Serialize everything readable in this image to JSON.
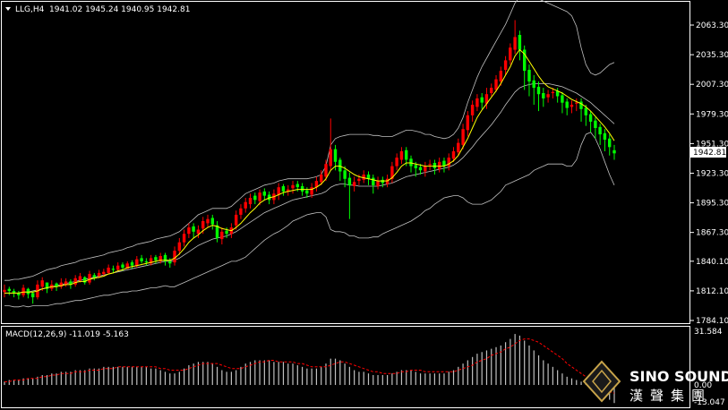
{
  "header": {
    "symbol": "LLG,H4",
    "ohlc": "1941.02 1945.24 1940.95 1942.81"
  },
  "current_price": "1942.81",
  "macd": {
    "label": "MACD(12,26,9) -11.019 -5.163",
    "top_label": "31.584",
    "mid_label": "0.00",
    "bot_label": "-13.047"
  },
  "brand": {
    "name": "SINO SOUND",
    "chinese": "漢聲集團"
  },
  "colors": {
    "bull": "#ff0000",
    "bear": "#00ff00",
    "ma": "#ffff00",
    "bands": "#c0c0c0",
    "signal": "#ff0000",
    "hist": "#c0c0c0"
  },
  "chart_data": {
    "type": "candlestick",
    "price_axis": [
      "2063.30",
      "2035.30",
      "2007.30",
      "1979.30",
      "1951.30",
      "1923.30",
      "1895.30",
      "1867.30",
      "1840.10",
      "1812.10",
      "1784.10"
    ],
    "ylim": [
      1784.1,
      2063.3
    ],
    "close": [
      1813,
      1812,
      1810,
      1808,
      1815,
      1809,
      1806,
      1818,
      1822,
      1814,
      1818,
      1816,
      1820,
      1821,
      1818,
      1824,
      1826,
      1820,
      1828,
      1825,
      1829,
      1830,
      1834,
      1832,
      1836,
      1834,
      1838,
      1836,
      1842,
      1840,
      1839,
      1843,
      1841,
      1845,
      1840,
      1838,
      1850,
      1858,
      1866,
      1872,
      1868,
      1870,
      1878,
      1880,
      1875,
      1862,
      1868,
      1866,
      1872,
      1884,
      1890,
      1896,
      1900,
      1898,
      1905,
      1902,
      1898,
      1904,
      1910,
      1906,
      1908,
      1912,
      1910,
      1906,
      1904,
      1910,
      1916,
      1922,
      1932,
      1946,
      1934,
      1925,
      1918,
      1912,
      1915,
      1918,
      1922,
      1918,
      1912,
      1916,
      1914,
      1918,
      1930,
      1938,
      1944,
      1936,
      1930,
      1928,
      1926,
      1930,
      1932,
      1928,
      1934,
      1930,
      1938,
      1944,
      1952,
      1965,
      1978,
      1988,
      1994,
      1990,
      1998,
      2004,
      2012,
      2020,
      2030,
      2042,
      2052,
      2040,
      2020,
      2010,
      2004,
      1998,
      1994,
      1998,
      2000,
      1996,
      1990,
      1985,
      1988,
      1990,
      1984,
      1978,
      1972,
      1966,
      1960,
      1955,
      1948,
      1942
    ],
    "open": [
      1811,
      1814,
      1812,
      1810,
      1808,
      1814,
      1810,
      1806,
      1816,
      1820,
      1814,
      1819,
      1816,
      1818,
      1821,
      1818,
      1822,
      1825,
      1820,
      1827,
      1826,
      1828,
      1829,
      1833,
      1832,
      1837,
      1833,
      1839,
      1836,
      1843,
      1840,
      1838,
      1844,
      1840,
      1846,
      1840,
      1839,
      1850,
      1858,
      1866,
      1873,
      1866,
      1871,
      1876,
      1881,
      1874,
      1861,
      1869,
      1866,
      1874,
      1884,
      1890,
      1894,
      1902,
      1897,
      1906,
      1903,
      1898,
      1903,
      1911,
      1906,
      1909,
      1913,
      1911,
      1907,
      1903,
      1910,
      1915,
      1920,
      1930,
      1946,
      1936,
      1926,
      1919,
      1911,
      1916,
      1917,
      1922,
      1919,
      1911,
      1917,
      1913,
      1918,
      1930,
      1936,
      1945,
      1937,
      1931,
      1929,
      1925,
      1931,
      1933,
      1927,
      1935,
      1930,
      1937,
      1943,
      1950,
      1964,
      1978,
      1986,
      1995,
      1989,
      1999,
      2002,
      2010,
      2021,
      2030,
      2040,
      2054,
      2040,
      2021,
      2011,
      2005,
      1999,
      1995,
      1999,
      2001,
      1997,
      1991,
      1986,
      1989,
      1991,
      1985,
      1979,
      1973,
      1967,
      1961,
      1956,
      1945
    ],
    "high": [
      1818,
      1816,
      1814,
      1812,
      1818,
      1815,
      1812,
      1822,
      1825,
      1820,
      1822,
      1820,
      1824,
      1824,
      1823,
      1827,
      1829,
      1826,
      1831,
      1829,
      1832,
      1833,
      1837,
      1836,
      1839,
      1839,
      1840,
      1841,
      1845,
      1846,
      1843,
      1846,
      1846,
      1848,
      1848,
      1843,
      1854,
      1862,
      1870,
      1876,
      1876,
      1874,
      1882,
      1884,
      1884,
      1878,
      1872,
      1872,
      1876,
      1888,
      1894,
      1900,
      1904,
      1905,
      1908,
      1909,
      1906,
      1908,
      1914,
      1913,
      1912,
      1916,
      1916,
      1914,
      1910,
      1914,
      1920,
      1926,
      1936,
      1975,
      1950,
      1938,
      1930,
      1924,
      1920,
      1922,
      1926,
      1925,
      1922,
      1920,
      1920,
      1922,
      1934,
      1942,
      1948,
      1948,
      1940,
      1934,
      1932,
      1934,
      1936,
      1936,
      1938,
      1938,
      1942,
      1948,
      1956,
      1970,
      1982,
      1992,
      1998,
      1999,
      2004,
      2008,
      2016,
      2024,
      2034,
      2046,
      2068,
      2058,
      2044,
      2026,
      2016,
      2010,
      2004,
      2002,
      2004,
      2004,
      2000,
      1994,
      1992,
      1994,
      1994,
      1988,
      1982,
      1976,
      1970,
      1965,
      1960,
      1950
    ],
    "low": [
      1806,
      1808,
      1806,
      1804,
      1806,
      1805,
      1800,
      1804,
      1812,
      1810,
      1812,
      1812,
      1814,
      1816,
      1814,
      1816,
      1820,
      1818,
      1818,
      1822,
      1824,
      1826,
      1828,
      1829,
      1831,
      1831,
      1833,
      1833,
      1834,
      1838,
      1836,
      1836,
      1838,
      1838,
      1836,
      1834,
      1836,
      1846,
      1854,
      1862,
      1862,
      1862,
      1866,
      1872,
      1870,
      1858,
      1856,
      1862,
      1862,
      1870,
      1880,
      1886,
      1890,
      1894,
      1893,
      1898,
      1894,
      1894,
      1898,
      1902,
      1902,
      1904,
      1906,
      1902,
      1900,
      1900,
      1906,
      1912,
      1916,
      1926,
      1926,
      1916,
      1910,
      1880,
      1906,
      1912,
      1914,
      1912,
      1904,
      1908,
      1910,
      1910,
      1914,
      1926,
      1932,
      1930,
      1924,
      1920,
      1922,
      1920,
      1926,
      1922,
      1924,
      1924,
      1926,
      1934,
      1940,
      1946,
      1958,
      1972,
      1982,
      1984,
      1984,
      1996,
      2000,
      2006,
      2016,
      2026,
      2036,
      2030,
      2002,
      1996,
      1988,
      1982,
      1986,
      1990,
      1994,
      1990,
      1980,
      1978,
      1980,
      1982,
      1972,
      1968,
      1962,
      1956,
      1950,
      1944,
      1940,
      1936
    ],
    "bands_upper": [
      1822,
      1822,
      1823,
      1823,
      1824,
      1825,
      1826,
      1828,
      1830,
      1832,
      1833,
      1834,
      1836,
      1837,
      1838,
      1839,
      1841,
      1842,
      1843,
      1844,
      1845,
      1846,
      1848,
      1849,
      1850,
      1851,
      1853,
      1854,
      1856,
      1857,
      1858,
      1859,
      1861,
      1862,
      1863,
      1864,
      1866,
      1868,
      1872,
      1876,
      1880,
      1884,
      1886,
      1888,
      1890,
      1890,
      1890,
      1890,
      1892,
      1896,
      1900,
      1904,
      1906,
      1908,
      1910,
      1912,
      1913,
      1914,
      1916,
      1917,
      1918,
      1918,
      1918,
      1918,
      1918,
      1919,
      1920,
      1922,
      1930,
      1950,
      1956,
      1958,
      1959,
      1960,
      1960,
      1960,
      1960,
      1960,
      1959,
      1959,
      1958,
      1958,
      1958,
      1960,
      1962,
      1964,
      1964,
      1963,
      1962,
      1960,
      1960,
      1958,
      1957,
      1956,
      1957,
      1960,
      1966,
      1976,
      1990,
      2002,
      2014,
      2024,
      2032,
      2040,
      2048,
      2056,
      2064,
      2074,
      2084,
      2090,
      2092,
      2092,
      2090,
      2088,
      2086,
      2084,
      2082,
      2080,
      2078,
      2076,
      2072,
      2062,
      2042,
      2026,
      2018,
      2016,
      2018,
      2022,
      2026,
      2028
    ],
    "bands_middle": [
      1810,
      1810,
      1810,
      1810,
      1811,
      1811,
      1812,
      1813,
      1814,
      1815,
      1816,
      1817,
      1818,
      1819,
      1820,
      1821,
      1822,
      1823,
      1824,
      1825,
      1826,
      1827,
      1828,
      1829,
      1830,
      1831,
      1832,
      1833,
      1834,
      1835,
      1836,
      1837,
      1838,
      1839,
      1840,
      1840,
      1841,
      1843,
      1846,
      1849,
      1852,
      1855,
      1857,
      1859,
      1861,
      1862,
      1863,
      1864,
      1866,
      1868,
      1871,
      1874,
      1877,
      1880,
      1883,
      1886,
      1888,
      1890,
      1892,
      1894,
      1896,
      1898,
      1899,
      1900,
      1901,
      1902,
      1903,
      1904,
      1906,
      1910,
      1912,
      1913,
      1913,
      1912,
      1912,
      1911,
      1911,
      1911,
      1911,
      1911,
      1912,
      1913,
      1914,
      1916,
      1918,
      1920,
      1921,
      1922,
      1923,
      1924,
      1925,
      1926,
      1927,
      1928,
      1929,
      1931,
      1934,
      1938,
      1943,
      1948,
      1954,
      1959,
      1964,
      1969,
      1975,
      1981,
      1988,
      1994,
      2000,
      2004,
      2006,
      2007,
      2008,
      2008,
      2008,
      2008,
      2007,
      2006,
      2005,
      2003,
      2001,
      1999,
      1996,
      1993,
      1990,
      1986,
      1982,
      1978,
      1974,
      1970
    ],
    "bands_lower": [
      1798,
      1798,
      1797,
      1797,
      1798,
      1797,
      1798,
      1798,
      1798,
      1798,
      1799,
      1800,
      1800,
      1801,
      1802,
      1803,
      1803,
      1804,
      1805,
      1806,
      1807,
      1808,
      1808,
      1809,
      1810,
      1811,
      1811,
      1812,
      1812,
      1813,
      1814,
      1815,
      1815,
      1816,
      1817,
      1816,
      1816,
      1818,
      1820,
      1822,
      1824,
      1826,
      1828,
      1830,
      1832,
      1834,
      1836,
      1838,
      1840,
      1840,
      1842,
      1844,
      1848,
      1852,
      1856,
      1860,
      1863,
      1866,
      1868,
      1871,
      1874,
      1878,
      1880,
      1882,
      1884,
      1885,
      1886,
      1886,
      1882,
      1870,
      1868,
      1868,
      1867,
      1864,
      1864,
      1862,
      1862,
      1862,
      1863,
      1863,
      1866,
      1868,
      1870,
      1872,
      1874,
      1876,
      1878,
      1881,
      1884,
      1888,
      1890,
      1894,
      1897,
      1900,
      1901,
      1902,
      1902,
      1900,
      1896,
      1894,
      1894,
      1894,
      1896,
      1898,
      1902,
      1906,
      1912,
      1914,
      1916,
      1918,
      1920,
      1922,
      1926,
      1928,
      1930,
      1932,
      1932,
      1932,
      1932,
      1930,
      1930,
      1936,
      1950,
      1960,
      1962,
      1956,
      1946,
      1934,
      1922,
      1912
    ],
    "ma": [
      1810,
      1810,
      1810,
      1810,
      1811,
      1811,
      1811,
      1812,
      1814,
      1815,
      1816,
      1816,
      1817,
      1818,
      1818,
      1820,
      1821,
      1821,
      1823,
      1824,
      1825,
      1826,
      1828,
      1829,
      1831,
      1832,
      1834,
      1835,
      1836,
      1837,
      1838,
      1839,
      1840,
      1841,
      1841,
      1841,
      1843,
      1847,
      1852,
      1858,
      1862,
      1865,
      1869,
      1872,
      1874,
      1873,
      1871,
      1870,
      1869,
      1872,
      1876,
      1881,
      1886,
      1890,
      1895,
      1898,
      1900,
      1901,
      1903,
      1905,
      1906,
      1907,
      1908,
      1908,
      1908,
      1908,
      1910,
      1913,
      1918,
      1926,
      1930,
      1930,
      1928,
      1925,
      1922,
      1920,
      1919,
      1918,
      1917,
      1916,
      1916,
      1916,
      1919,
      1924,
      1930,
      1933,
      1933,
      1932,
      1931,
      1930,
      1930,
      1930,
      1930,
      1930,
      1932,
      1935,
      1940,
      1948,
      1956,
      1966,
      1976,
      1983,
      1989,
      1995,
      2001,
      2008,
      2016,
      2024,
      2034,
      2040,
      2036,
      2029,
      2022,
      2015,
      2009,
      2005,
      2003,
      2001,
      1999,
      1996,
      1993,
      1991,
      1989,
      1986,
      1982,
      1977,
      1972,
      1967,
      1961,
      1954
    ],
    "macd_hist": [
      2,
      3,
      3,
      3,
      4,
      4,
      4,
      5,
      6,
      6,
      7,
      7,
      8,
      8,
      8,
      9,
      9,
      9,
      10,
      10,
      10,
      11,
      11,
      11,
      11,
      11,
      11,
      11,
      11,
      11,
      11,
      10,
      10,
      9,
      8,
      7,
      7,
      8,
      10,
      12,
      13,
      14,
      14,
      14,
      13,
      11,
      9,
      8,
      8,
      9,
      11,
      13,
      14,
      15,
      15,
      15,
      15,
      14,
      14,
      14,
      13,
      13,
      12,
      11,
      10,
      10,
      10,
      11,
      13,
      16,
      16,
      15,
      13,
      11,
      9,
      8,
      8,
      7,
      6,
      6,
      6,
      6,
      7,
      8,
      9,
      9,
      9,
      8,
      7,
      7,
      7,
      7,
      7,
      7,
      8,
      9,
      11,
      13,
      15,
      17,
      19,
      20,
      21,
      22,
      23,
      24,
      26,
      28,
      31,
      30,
      27,
      24,
      21,
      18,
      15,
      13,
      11,
      9,
      7,
      5,
      4,
      3,
      2,
      1,
      0,
      -2,
      -4,
      -6,
      -9,
      -11
    ],
    "macd_signal": [
      2,
      2,
      3,
      3,
      3,
      4,
      4,
      4,
      5,
      5,
      6,
      6,
      7,
      7,
      7,
      8,
      8,
      8,
      9,
      9,
      9,
      10,
      10,
      10,
      11,
      11,
      11,
      11,
      11,
      11,
      11,
      11,
      11,
      10,
      10,
      9,
      9,
      9,
      9,
      10,
      11,
      12,
      13,
      13,
      13,
      13,
      12,
      11,
      10,
      10,
      10,
      11,
      12,
      13,
      14,
      14,
      15,
      15,
      14,
      14,
      14,
      14,
      13,
      13,
      12,
      11,
      11,
      11,
      11,
      12,
      13,
      14,
      14,
      13,
      12,
      11,
      10,
      9,
      8,
      8,
      7,
      7,
      7,
      7,
      8,
      8,
      9,
      9,
      9,
      8,
      8,
      8,
      8,
      8,
      8,
      8,
      9,
      10,
      11,
      12,
      14,
      15,
      16,
      18,
      19,
      20,
      22,
      23,
      25,
      27,
      28,
      28,
      27,
      26,
      24,
      22,
      20,
      18,
      16,
      13,
      11,
      9,
      7,
      5,
      3,
      1,
      -1,
      -3,
      -4,
      -5
    ]
  }
}
